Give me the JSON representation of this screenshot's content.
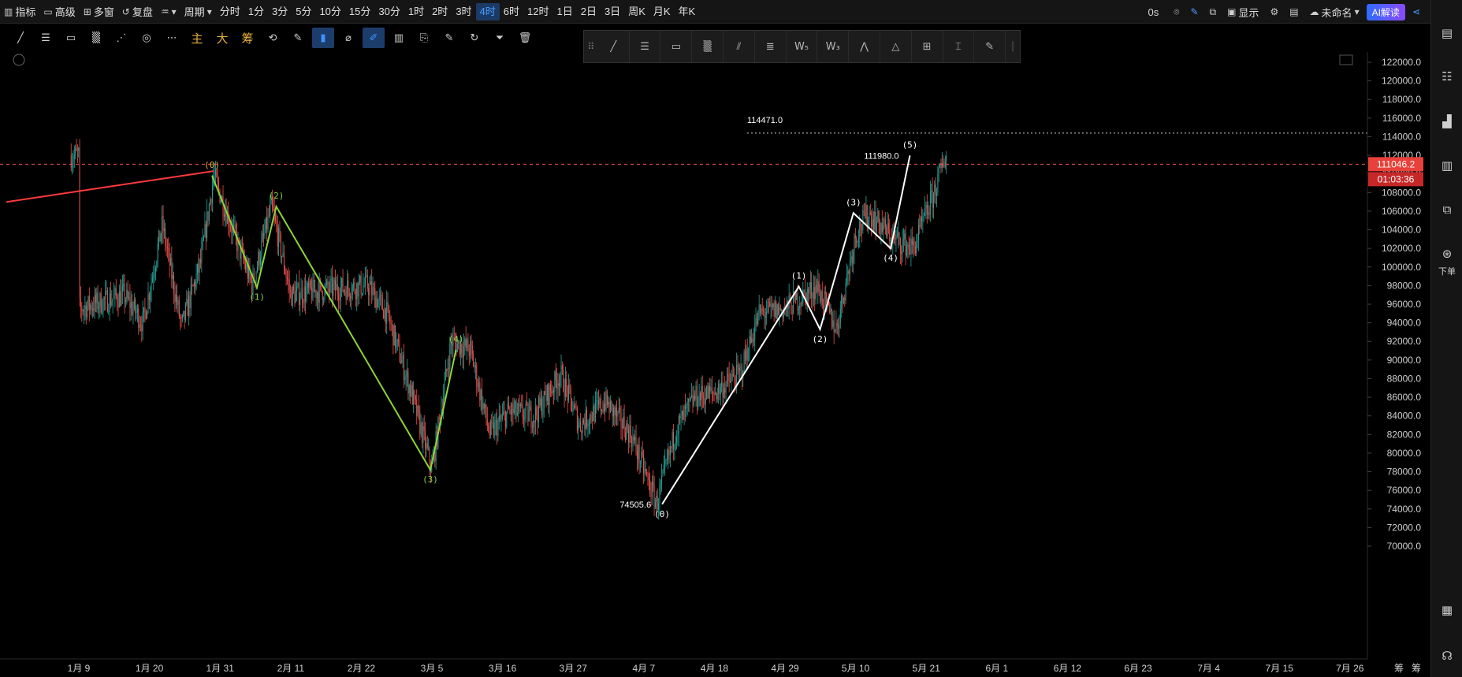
{
  "toolbar": {
    "indicator": "指标",
    "advanced": "高级",
    "multiwindow": "多窗",
    "restore": "复盘",
    "period_label": "周期",
    "periods": [
      "分时",
      "1分",
      "3分",
      "5分",
      "10分",
      "15分",
      "30分",
      "1时",
      "2时",
      "3时",
      "4时",
      "6时",
      "12时",
      "1日",
      "2日",
      "3日",
      "周K",
      "月K",
      "年K"
    ],
    "active_period": "4时",
    "latency": "0s",
    "display": "显示",
    "unnamed": "未命名",
    "ai": "AI解读"
  },
  "drawbar": {
    "text_main": "主",
    "text_big": "大",
    "text_chip": "筹"
  },
  "sidebar": {
    "order_label": "下单"
  },
  "chart_data": {
    "type": "candlestick",
    "y_ticks": [
      122000,
      120000,
      118000,
      116000,
      114000,
      112000,
      110000,
      108000,
      106000,
      104000,
      102000,
      100000,
      98000,
      96000,
      94000,
      92000,
      90000,
      88000,
      86000,
      84000,
      82000,
      80000,
      78000,
      76000,
      74000,
      72000,
      70000
    ],
    "ylim": [
      69500,
      122500
    ],
    "x_ticks": [
      "1月 9",
      "1月 20",
      "1月 31",
      "2月 11",
      "2月 22",
      "3月 5",
      "3月 16",
      "3月 27",
      "4月 7",
      "4月 18",
      "4月 29",
      "5月 10",
      "5月 21",
      "6月 1",
      "6月 12",
      "6月 23",
      "7月 4",
      "7月 15",
      "7月 26"
    ],
    "x_tick_offsets_days": [
      0,
      11,
      22,
      33,
      44,
      55,
      66,
      77,
      88,
      99,
      110,
      121,
      132,
      143,
      154,
      165,
      176,
      187,
      198
    ],
    "current_price": "111046.2",
    "countdown": "01:03:36",
    "price_labels": [
      {
        "text": "114471.0",
        "price": 114471
      },
      {
        "text": "111980.0",
        "price": 111980
      },
      {
        "text": "74505.6",
        "price": 74505.6
      }
    ],
    "red_line": {
      "price_start": 108000,
      "price_end": 109800
    },
    "green_wave": {
      "labels": [
        "(0)",
        "(1)",
        "(2)",
        "(3)",
        "(4)"
      ],
      "prices": [
        109800,
        97800,
        106500,
        78200,
        91100
      ]
    },
    "white_wave": {
      "labels": [
        "(0)",
        "(1)",
        "(2)",
        "(3)",
        "(4)",
        "(5)"
      ],
      "prices": [
        74505.6,
        97900,
        93300,
        105800,
        102000,
        111980
      ]
    },
    "bottom_right_labels": [
      "筹",
      "筹"
    ],
    "colors": {
      "up": "#26a69a",
      "down": "#ef5350",
      "green_wave": "#8bd43a",
      "white_wave": "#ffffff",
      "red_line": "#ff3a3a",
      "orange_label": "#e8b13a"
    }
  }
}
